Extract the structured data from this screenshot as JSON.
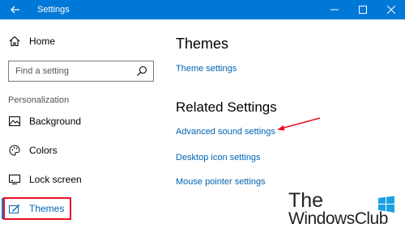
{
  "window": {
    "title": "Settings"
  },
  "sidebar": {
    "home_label": "Home",
    "search_placeholder": "Find a setting",
    "section_label": "Personalization",
    "items": [
      {
        "label": "Background",
        "icon": "background-icon"
      },
      {
        "label": "Colors",
        "icon": "palette-icon"
      },
      {
        "label": "Lock screen",
        "icon": "lock-screen-icon"
      },
      {
        "label": "Themes",
        "icon": "themes-icon",
        "selected": true
      }
    ]
  },
  "main": {
    "heading": "Themes",
    "theme_settings_link": "Theme settings",
    "related_heading": "Related Settings",
    "related_links": [
      "Advanced sound settings",
      "Desktop icon settings",
      "Mouse pointer settings"
    ]
  },
  "watermark": {
    "line1": "The",
    "line2": "WindowsClub"
  },
  "colors": {
    "titlebar": "#0078d7",
    "link": "#0063b1",
    "highlight": "#e81123"
  }
}
